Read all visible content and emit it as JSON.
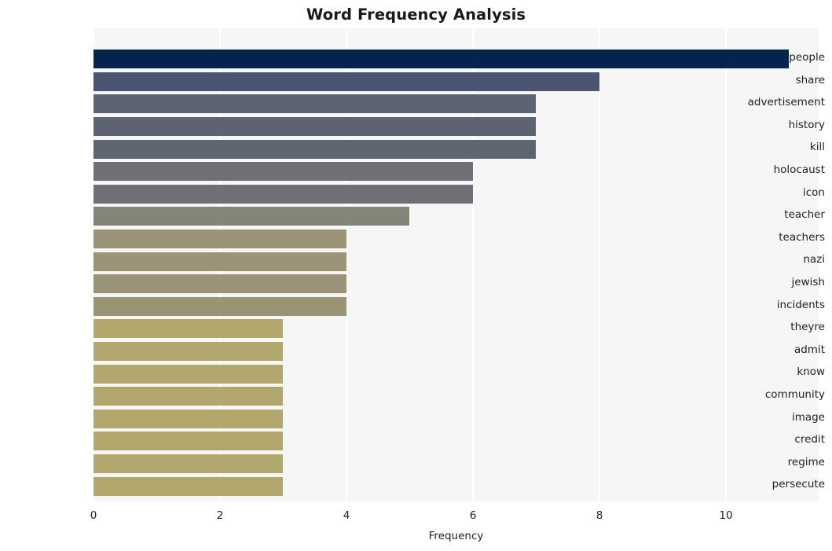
{
  "chart_data": {
    "type": "bar",
    "orientation": "horizontal",
    "title": "Word Frequency Analysis",
    "xlabel": "Frequency",
    "ylabel": "",
    "xlim": [
      0,
      11.466
    ],
    "xticks": [
      0,
      2,
      4,
      6,
      8,
      10
    ],
    "xtick_labels": [
      "0",
      "2",
      "4",
      "6",
      "8",
      "10"
    ],
    "grid": "vertical-only",
    "legend": "none",
    "categories": [
      "people",
      "share",
      "advertisement",
      "history",
      "kill",
      "holocaust",
      "icon",
      "teacher",
      "teachers",
      "nazi",
      "jewish",
      "incidents",
      "theyre",
      "admit",
      "know",
      "community",
      "image",
      "credit",
      "regime",
      "persecute"
    ],
    "values": [
      11,
      8,
      7,
      7,
      7,
      6,
      6,
      5,
      4,
      4,
      4,
      4,
      3,
      3,
      3,
      3,
      3,
      3,
      3,
      3
    ],
    "bar_colors": [
      "#04234d",
      "#4b5571",
      "#5e6373",
      "#5e6373",
      "#5f6473",
      "#6e7075",
      "#6e7075",
      "#848577",
      "#9a9376",
      "#9a9376",
      "#9a9376",
      "#9a9376",
      "#b3a86c",
      "#b3a86c",
      "#b3a86c",
      "#b3a86c",
      "#b3a86c",
      "#b3a86c",
      "#b3a86c",
      "#b3a86c"
    ],
    "colors": {
      "plot_background": "#f6f6f7",
      "figure_background": "#ffffff",
      "gridline": "#ffffff",
      "text": "#1f1f1f",
      "title": "#1a1a1a",
      "palette_start": "#04234d",
      "palette_end": "#b3a86c"
    }
  }
}
